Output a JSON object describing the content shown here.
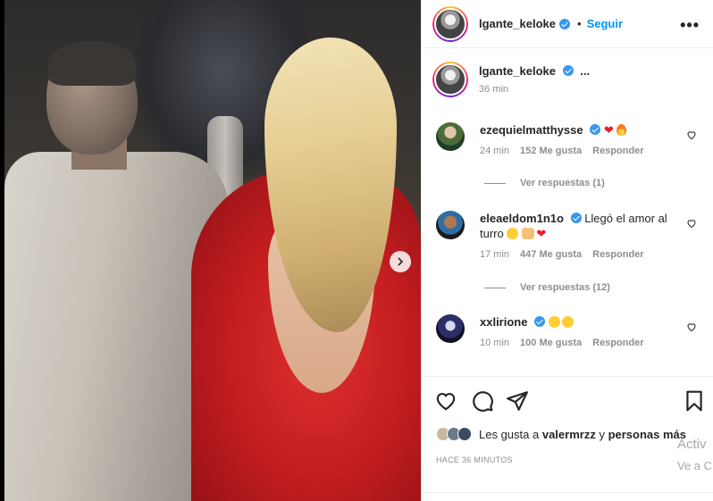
{
  "post": {
    "author": "lgante_keloke",
    "follow_label": "Seguir",
    "dot": "•",
    "more_label": "•••",
    "caption_more": "...",
    "caption_time": "36 min",
    "next_icon": "chevron-right-icon",
    "posted_ago": "HACE 36 MINUTOS"
  },
  "comments": [
    {
      "user": "ezequielmatthysse",
      "verified": true,
      "time": "24 min",
      "likes": "152 Me gusta",
      "reply": "Responder",
      "replies_label": "Ver respuestas (1)"
    },
    {
      "user": "eleaeldom1n1o",
      "verified": true,
      "text": "Llegó el amor al turro",
      "time": "17 min",
      "likes": "447 Me gusta",
      "reply": "Responder",
      "replies_label": "Ver respuestas (12)"
    },
    {
      "user": "xxlirione",
      "verified": true,
      "time": "10 min",
      "likes": "100 Me gusta",
      "reply": "Responder"
    }
  ],
  "likes": {
    "prefix": "Les gusta a",
    "user": "valermrzz",
    "middle": "y",
    "others": "personas más"
  },
  "overlay": {
    "line1": "Activ",
    "line2": "Ve a C"
  },
  "colors": {
    "accent": "#0095f6",
    "verified": "#3897f0",
    "heart": "#ed1c24",
    "dress": "#c21d20"
  }
}
